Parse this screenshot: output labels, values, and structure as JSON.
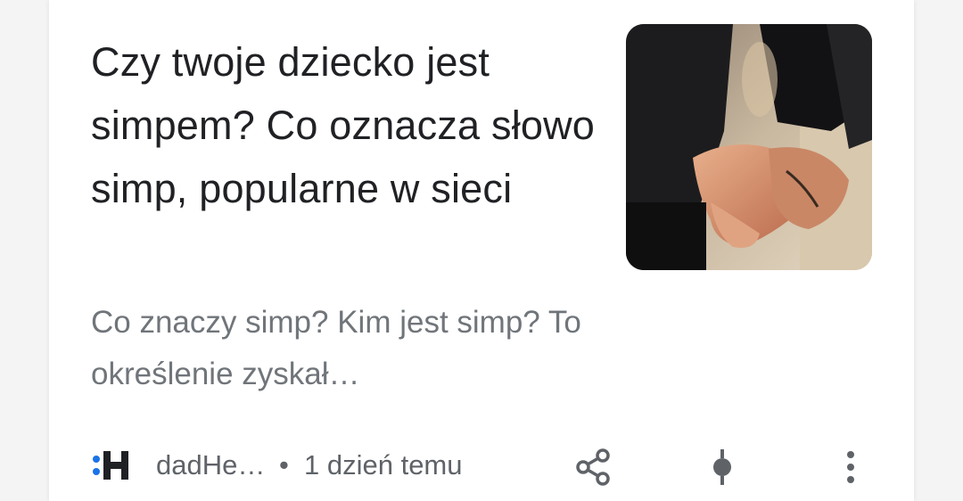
{
  "article": {
    "headline": "Czy twoje dziecko jest simpem? Co oznacza słowo simp, popularne w sieci",
    "snippet": "Co znaczy simp? Kim jest simp? To określenie zyskał…",
    "thumbnail_icon": "photo-hands-holding"
  },
  "source": {
    "logo_text": ":H",
    "logo_icon": "dadhero-logo-icon",
    "name": "dadHe…",
    "separator": "•",
    "time": "1 dzień temu"
  },
  "actions": {
    "share_icon": "share-icon",
    "pin_icon": "pin-icon",
    "more_icon": "more-vert-icon"
  },
  "colors": {
    "headline": "#202124",
    "snippet": "#70757a",
    "meta": "#5f6368",
    "logo_accent": "#1a73e8"
  }
}
